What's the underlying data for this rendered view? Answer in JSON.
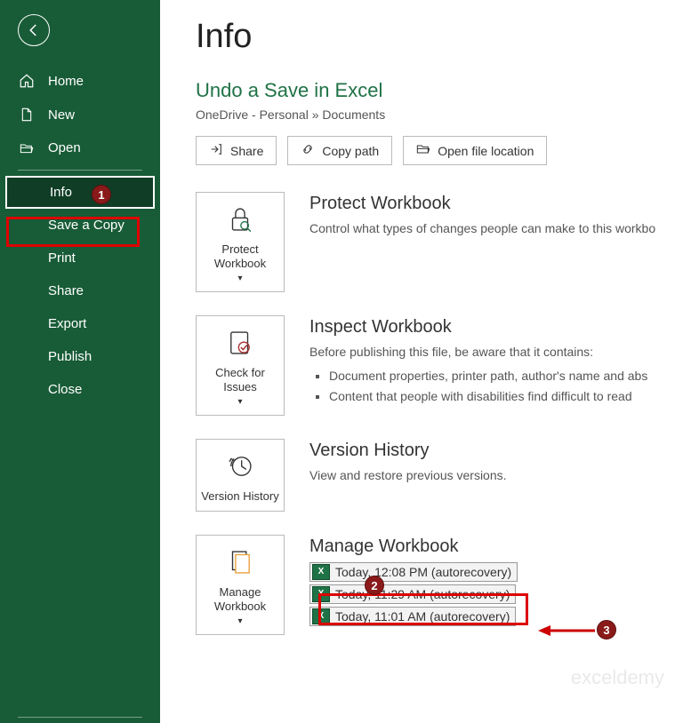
{
  "sidebar": {
    "items": [
      {
        "label": "Home"
      },
      {
        "label": "New"
      },
      {
        "label": "Open"
      },
      {
        "label": "Info"
      },
      {
        "label": "Save a Copy"
      },
      {
        "label": "Print"
      },
      {
        "label": "Share"
      },
      {
        "label": "Export"
      },
      {
        "label": "Publish"
      },
      {
        "label": "Close"
      }
    ]
  },
  "page": {
    "title": "Info",
    "docTitle": "Undo a Save in Excel",
    "breadcrumb": "OneDrive - Personal » Documents"
  },
  "toolbar": {
    "share": "Share",
    "copyPath": "Copy path",
    "openLocation": "Open file location"
  },
  "sections": {
    "protect": {
      "btn": "Protect Workbook",
      "title": "Protect Workbook",
      "desc": "Control what types of changes people can make to this workbo"
    },
    "inspect": {
      "btn": "Check for Issues",
      "title": "Inspect Workbook",
      "desc": "Before publishing this file, be aware that it contains:",
      "bullets": [
        "Document properties, printer path, author's name and abs",
        "Content that people with disabilities find difficult to read"
      ]
    },
    "version": {
      "btn": "Version History",
      "title": "Version History",
      "desc": "View and restore previous versions."
    },
    "manage": {
      "btn": "Manage Workbook",
      "title": "Manage Workbook",
      "versions": [
        "Today, 12:08 PM (autorecovery)",
        "Today, 11:29 AM (autorecovery)",
        "Today, 11:01 AM (autorecovery)"
      ]
    }
  },
  "callouts": {
    "c1": "1",
    "c2": "2",
    "c3": "3"
  }
}
